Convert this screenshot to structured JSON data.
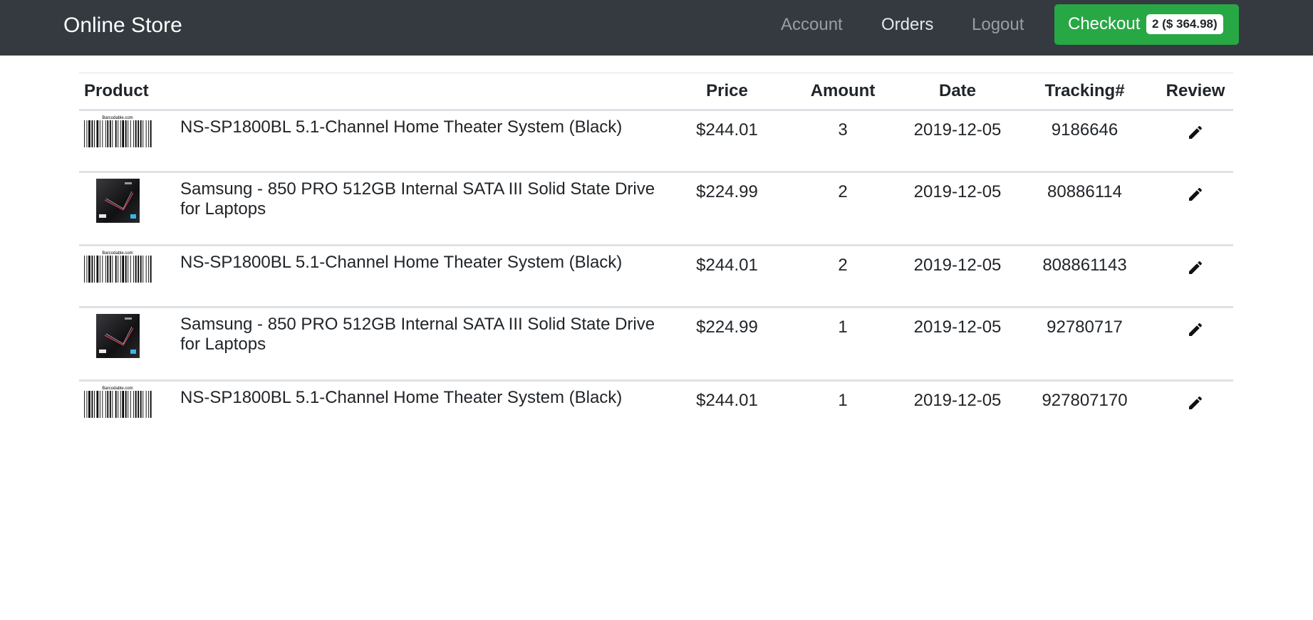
{
  "navbar": {
    "brand": "Online Store",
    "links": {
      "account": "Account",
      "orders": "Orders",
      "logout": "Logout"
    },
    "checkout": {
      "label": "Checkout",
      "badge": "2 ($ 364.98)"
    }
  },
  "table": {
    "headers": {
      "product": "Product",
      "price": "Price",
      "amount": "Amount",
      "date": "Date",
      "tracking": "Tracking#",
      "review": "Review"
    },
    "rows": [
      {
        "image": "barcode-image",
        "image_caption": "Barcodable.com",
        "name": "NS-SP1800BL 5.1-Channel Home Theater System (Black)",
        "price": "$244.01",
        "amount": "3",
        "date": "2019-12-05",
        "tracking": "9186646"
      },
      {
        "image": "ssd-image",
        "name": "Samsung - 850 PRO 512GB Internal SATA III Solid State Drive for Laptops",
        "price": "$224.99",
        "amount": "2",
        "date": "2019-12-05",
        "tracking": "80886114"
      },
      {
        "image": "barcode-image",
        "image_caption": "Barcodable.com",
        "name": "NS-SP1800BL 5.1-Channel Home Theater System (Black)",
        "price": "$244.01",
        "amount": "2",
        "date": "2019-12-05",
        "tracking": "808861143"
      },
      {
        "image": "ssd-image",
        "name": "Samsung - 850 PRO 512GB Internal SATA III Solid State Drive for Laptops",
        "price": "$224.99",
        "amount": "1",
        "date": "2019-12-05",
        "tracking": "92780717"
      },
      {
        "image": "barcode-image",
        "image_caption": "Barcodable.com",
        "name": "NS-SP1800BL 5.1-Channel Home Theater System (Black)",
        "price": "$244.01",
        "amount": "1",
        "date": "2019-12-05",
        "tracking": "927807170"
      }
    ]
  },
  "colors": {
    "navbar_bg": "#343a40",
    "checkout_bg": "#28a745",
    "border": "#dee2e6"
  }
}
